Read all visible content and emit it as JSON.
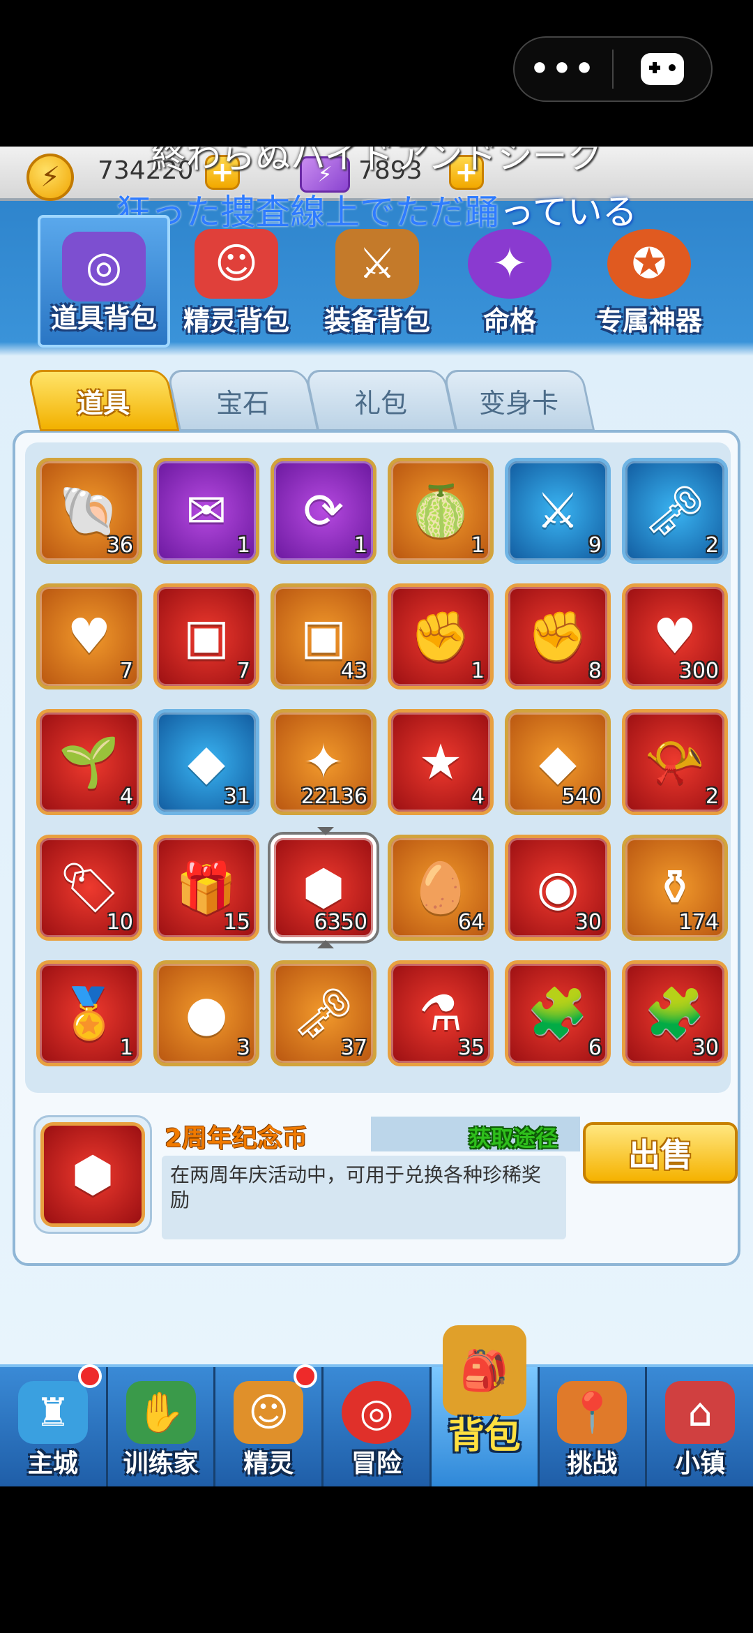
{
  "capsule": {
    "more_icon": "more-dots-icon",
    "game_icon": "gamepad-icon"
  },
  "resources": {
    "coins": "734220",
    "energy": "7893"
  },
  "lyrics": {
    "line1": "終わらぬハイドアンドシーク",
    "line2_highlight": "狂った捜査線上でただ踊",
    "line2_rest": "っている"
  },
  "categories": [
    {
      "label": "道具背包",
      "icon": "target-bag-icon",
      "color": "#7d4fd0"
    },
    {
      "label": "精灵背包",
      "icon": "spirit-chest-icon",
      "color": "#e0403a"
    },
    {
      "label": "装备背包",
      "icon": "equipment-chest-icon",
      "color": "#c47a2a"
    },
    {
      "label": "命格",
      "icon": "fate-orb-icon",
      "color": "#8a3ad0"
    },
    {
      "label": "专属神器",
      "icon": "artifact-medal-icon",
      "color": "#e05a20"
    }
  ],
  "tabs": [
    "道具",
    "宝石",
    "礼包",
    "变身卡"
  ],
  "items": [
    {
      "count": "36",
      "rarity": "orange",
      "icon": "clam-shell-icon",
      "glyph": "🐚"
    },
    {
      "count": "1",
      "rarity": "purple",
      "icon": "envelope-icon",
      "glyph": "✉"
    },
    {
      "count": "1",
      "rarity": "purple",
      "icon": "refresh-ticket-icon",
      "glyph": "⟳"
    },
    {
      "count": "1",
      "rarity": "orange",
      "icon": "golden-fruit-icon",
      "glyph": "🍈"
    },
    {
      "count": "9",
      "rarity": "blue",
      "icon": "battle-ticket-icon",
      "glyph": "⚔"
    },
    {
      "count": "2",
      "rarity": "blue",
      "icon": "bronze-key-icon",
      "glyph": "🗝"
    },
    {
      "count": "7",
      "rarity": "orange",
      "icon": "green-gem-icon",
      "glyph": "♥"
    },
    {
      "count": "7",
      "rarity": "red",
      "icon": "purple-card-icon",
      "glyph": "▣"
    },
    {
      "count": "43",
      "rarity": "orange",
      "icon": "blue-card-icon",
      "glyph": "▣"
    },
    {
      "count": "1",
      "rarity": "red",
      "icon": "gem-gauntlet-icon",
      "glyph": "✊"
    },
    {
      "count": "8",
      "rarity": "red",
      "icon": "gauntlet-icon",
      "glyph": "✊"
    },
    {
      "count": "300",
      "rarity": "red",
      "icon": "heart-badge-icon",
      "glyph": "♥"
    },
    {
      "count": "4",
      "rarity": "red",
      "icon": "sprout-icon",
      "glyph": "🌱"
    },
    {
      "count": "31",
      "rarity": "blue",
      "icon": "purple-gem-card-icon",
      "glyph": "◆"
    },
    {
      "count": "22136",
      "rarity": "orange",
      "icon": "purple-crystal-icon",
      "glyph": "✦"
    },
    {
      "count": "4",
      "rarity": "red",
      "icon": "star-coin-icon",
      "glyph": "★"
    },
    {
      "count": "540",
      "rarity": "orange",
      "icon": "blue-diamond-icon",
      "glyph": "◆"
    },
    {
      "count": "2",
      "rarity": "red",
      "icon": "horn-icon",
      "glyph": "📯"
    },
    {
      "count": "10",
      "rarity": "red",
      "icon": "tag-icon",
      "glyph": "🏷"
    },
    {
      "count": "15",
      "rarity": "red",
      "icon": "gift-box-icon",
      "glyph": "🎁"
    },
    {
      "count": "6350",
      "rarity": "red",
      "icon": "anniversary-coin-icon",
      "glyph": "⬢",
      "selected": true
    },
    {
      "count": "64",
      "rarity": "orange",
      "icon": "golden-egg-icon",
      "glyph": "🥚"
    },
    {
      "count": "30",
      "rarity": "red",
      "icon": "bunny-coin-icon",
      "glyph": "◉"
    },
    {
      "count": "174",
      "rarity": "orange",
      "icon": "potion-jar-icon",
      "glyph": "⚱"
    },
    {
      "count": "1",
      "rarity": "red",
      "icon": "monkey-medal-icon",
      "glyph": "🏅"
    },
    {
      "count": "3",
      "rarity": "orange",
      "icon": "blueberry-icon",
      "glyph": "●"
    },
    {
      "count": "37",
      "rarity": "orange",
      "icon": "golden-key-icon",
      "glyph": "🗝"
    },
    {
      "count": "35",
      "rarity": "red",
      "icon": "winged-potion-icon",
      "glyph": "⚗"
    },
    {
      "count": "6",
      "rarity": "red",
      "icon": "gold-puzzle-icon",
      "glyph": "🧩"
    },
    {
      "count": "30",
      "rarity": "red",
      "icon": "purple-puzzle-icon",
      "glyph": "🧩"
    }
  ],
  "detail": {
    "title": "2周年纪念币",
    "get_path": "获取途径",
    "description": "在两周年庆活动中，可用于兑换各种珍稀奖励",
    "sell": "出售",
    "icon": "anniversary-coin-icon"
  },
  "nav": [
    {
      "label": "主城",
      "icon": "castle-icon",
      "badge": true
    },
    {
      "label": "训练家",
      "icon": "glove-icon",
      "badge": false
    },
    {
      "label": "精灵",
      "icon": "spirit-icon",
      "badge": true
    },
    {
      "label": "冒险",
      "icon": "target-icon",
      "badge": false
    },
    {
      "label": "背包",
      "icon": "backpack-icon",
      "badge": false,
      "active": true
    },
    {
      "label": "挑战",
      "icon": "map-pin-icon",
      "badge": false
    },
    {
      "label": "小镇",
      "icon": "town-icon",
      "badge": false
    }
  ]
}
